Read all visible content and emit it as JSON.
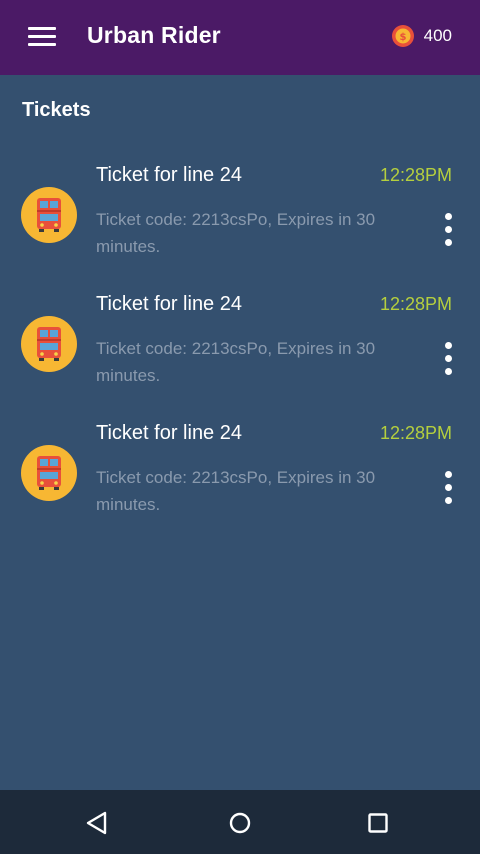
{
  "app_bar": {
    "title": "Urban Rider",
    "menu_icon": "hamburger-menu-icon",
    "coin_icon": "coin-icon",
    "coin_balance": "400",
    "background": "#4b1a66"
  },
  "main": {
    "section_title": "Tickets",
    "background": "#34506f",
    "tickets": [
      {
        "icon": "bus-icon",
        "title": "Ticket for line 24",
        "time": "12:28PM",
        "description": "Ticket code: 2213csPo, Expires in 30 minutes."
      },
      {
        "icon": "bus-icon",
        "title": "Ticket for line 24",
        "time": "12:28PM",
        "description": "Ticket code: 2213csPo, Expires in 30 minutes."
      },
      {
        "icon": "bus-icon",
        "title": "Ticket for line 24",
        "time": "12:28PM",
        "description": "Ticket code: 2213csPo, Expires in 30 minutes."
      }
    ]
  },
  "system_nav": {
    "back_icon": "back-triangle-icon",
    "home_icon": "home-circle-icon",
    "recents_icon": "recents-square-icon"
  },
  "colors": {
    "accent_time": "#b5cf3e",
    "avatar": "#f7b733",
    "nav_bar": "#1d2a3a"
  }
}
